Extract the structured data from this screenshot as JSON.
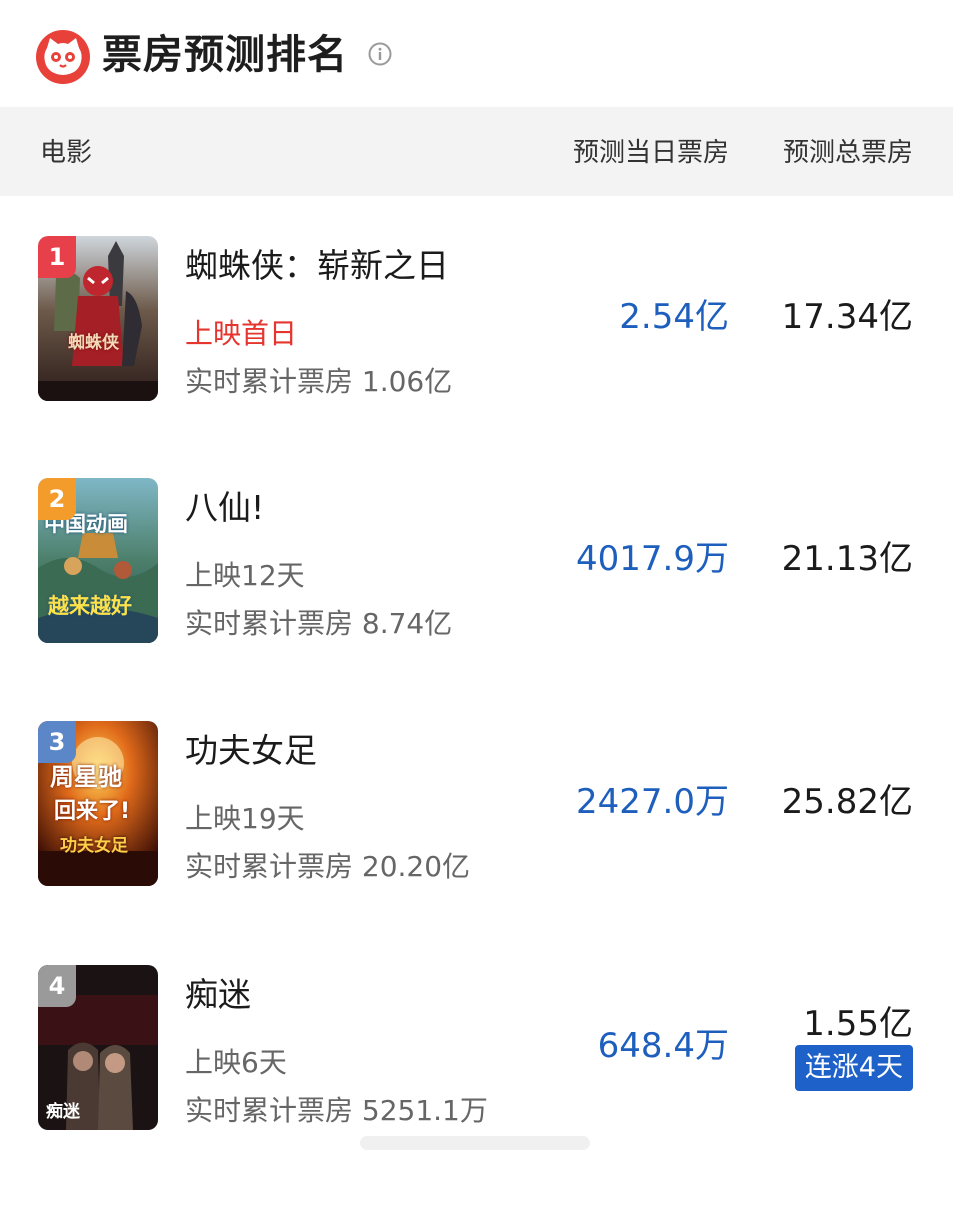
{
  "header": {
    "title": "票房预测排名"
  },
  "columns": {
    "movie": "电影",
    "day_box": "预测当日票房",
    "total_box": "预测总票房"
  },
  "movies": [
    {
      "rank": "1",
      "name": "蜘蛛侠：崭新之日",
      "release": "上映首日",
      "cumulative": "实时累计票房 1.06亿",
      "day_box": "2.54亿",
      "total_box": "17.34亿",
      "poster_text": "蜘蛛侠"
    },
    {
      "rank": "2",
      "name": "八仙!",
      "release": "上映12天",
      "cumulative": "实时累计票房 8.74亿",
      "day_box": "4017.9万",
      "total_box": "21.13亿",
      "poster_text_1": "中国动画",
      "poster_text_2": "越来越好"
    },
    {
      "rank": "3",
      "name": "功夫女足",
      "release": "上映19天",
      "cumulative": "实时累计票房 20.20亿",
      "day_box": "2427.0万",
      "total_box": "25.82亿",
      "poster_text_1": "周星驰",
      "poster_text_2": "回来了!",
      "poster_text_3": "功夫女足"
    },
    {
      "rank": "4",
      "name": "痴迷",
      "release": "上映6天",
      "cumulative": "实时累计票房 5251.1万",
      "day_box": "648.4万",
      "total_box": "1.55亿",
      "trend": "连涨4天",
      "poster_text": "痴迷"
    }
  ],
  "colors": {
    "brand": "#e8413a",
    "blue_value": "#1e5fbd",
    "first_day_red": "#e5352f",
    "badge_blue": "#1e62c9",
    "rank1": "#e8404a",
    "rank2": "#f39c2b",
    "rank3": "#5b86c8",
    "rank4": "#9a9a9a"
  },
  "icons": [
    "cat-logo-icon",
    "info-icon"
  ]
}
